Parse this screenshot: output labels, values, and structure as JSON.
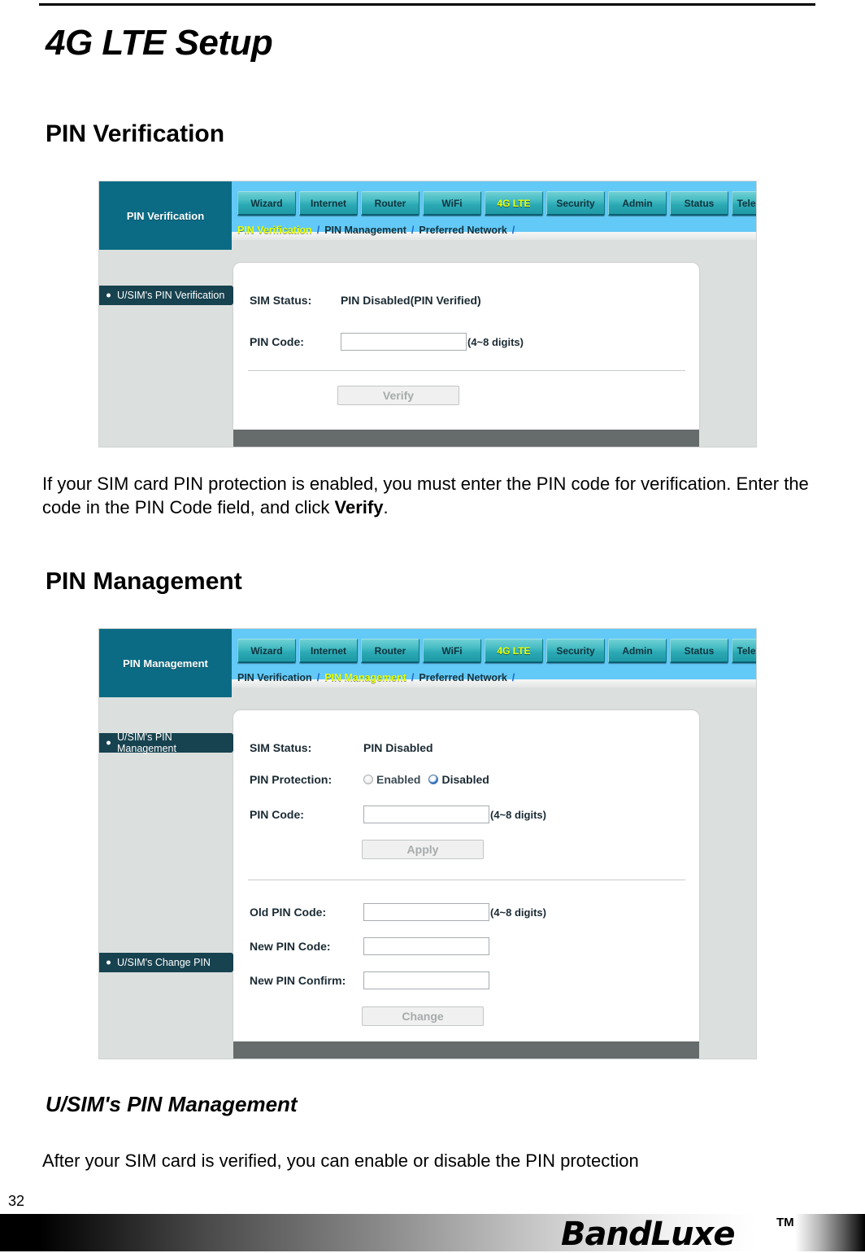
{
  "document": {
    "title": "4G LTE Setup",
    "page_number": "32",
    "sections": [
      {
        "heading": "PIN Verification",
        "body": "If your SIM card PIN protection is enabled, you must enter the PIN code for verification. Enter the code in the PIN Code field, and click ",
        "body_bold": "Verify",
        "body_tail": "."
      },
      {
        "heading": "PIN Management",
        "subheading": "U/SIM's PIN Management",
        "body": "After your SIM card is verified, you can enable or disable the PIN protection"
      }
    ]
  },
  "footer": {
    "brand": "BandLuxe",
    "trademark": "TM"
  },
  "screenshot1": {
    "page_title": "PIN Verification",
    "tabs": [
      {
        "label": "Wizard",
        "active": false
      },
      {
        "label": "Internet",
        "active": false
      },
      {
        "label": "Router",
        "active": false
      },
      {
        "label": "WiFi",
        "active": false
      },
      {
        "label": "4G LTE",
        "active": true
      },
      {
        "label": "Security",
        "active": false
      },
      {
        "label": "Admin",
        "active": false
      },
      {
        "label": "Status",
        "active": false
      },
      {
        "label": "Telephony",
        "active": false
      }
    ],
    "subnav": [
      {
        "label": "PIN Verification",
        "selected": true
      },
      {
        "label": "PIN Management",
        "selected": false
      },
      {
        "label": "Preferred Network",
        "selected": false
      }
    ],
    "subnav_separator": "/",
    "side_items": [
      {
        "label": "U/SIM's PIN Verification"
      }
    ],
    "form": {
      "sim_status_label": "SIM Status:",
      "sim_status_value": "PIN Disabled(PIN Verified)",
      "pin_code_label": "PIN Code:",
      "pin_code_value": "",
      "pin_code_hint": "(4~8 digits)",
      "verify_button": "Verify"
    }
  },
  "screenshot2": {
    "page_title": "PIN Management",
    "tabs": [
      {
        "label": "Wizard",
        "active": false
      },
      {
        "label": "Internet",
        "active": false
      },
      {
        "label": "Router",
        "active": false
      },
      {
        "label": "WiFi",
        "active": false
      },
      {
        "label": "4G LTE",
        "active": true
      },
      {
        "label": "Security",
        "active": false
      },
      {
        "label": "Admin",
        "active": false
      },
      {
        "label": "Status",
        "active": false
      },
      {
        "label": "Telephony",
        "active": false
      }
    ],
    "subnav": [
      {
        "label": "PIN Verification",
        "selected": false
      },
      {
        "label": "PIN Management",
        "selected": true
      },
      {
        "label": "Preferred Network",
        "selected": false
      }
    ],
    "subnav_separator": "/",
    "side_items": [
      {
        "label": "U/SIM's PIN Management"
      },
      {
        "label": "U/SIM's Change PIN"
      }
    ],
    "form": {
      "sim_status_label": "SIM Status:",
      "sim_status_value": "PIN Disabled",
      "pin_protection_label": "PIN Protection:",
      "pin_protection_enabled": "Enabled",
      "pin_protection_disabled": "Disabled",
      "pin_protection_selected": "Disabled",
      "pin_code_label": "PIN Code:",
      "pin_code_value": "",
      "pin_code_hint": "(4~8 digits)",
      "apply_button": "Apply",
      "old_pin_label": "Old PIN Code:",
      "old_pin_value": "",
      "old_pin_hint": "(4~8 digits)",
      "new_pin_label": "New PIN Code:",
      "new_pin_value": "",
      "new_pin_confirm_label": "New PIN Confirm:",
      "new_pin_confirm_value": "",
      "change_button": "Change"
    }
  },
  "colors": {
    "dark_teal": "#0b6b85",
    "light_blue": "#63c9f7",
    "tab_teal": "#2aa8b3",
    "active_yellow": "#eaff00",
    "side_navy": "#17424f",
    "panel_gray": "#dbe0de"
  }
}
